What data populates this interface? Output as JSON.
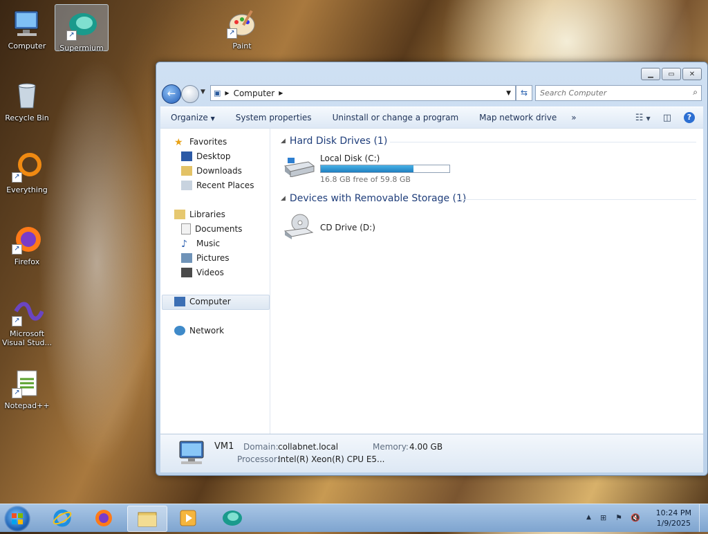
{
  "desktop": {
    "icons": [
      {
        "label": "Computer"
      },
      {
        "label": "Supermium"
      },
      {
        "label": "Paint"
      },
      {
        "label": "Recycle Bin"
      },
      {
        "label": "Everything"
      },
      {
        "label": "Firefox"
      },
      {
        "label": "Microsoft Visual Stud..."
      },
      {
        "label": "Notepad++"
      }
    ]
  },
  "window": {
    "address": {
      "crumb": "Computer"
    },
    "search": {
      "placeholder": "Search Computer"
    },
    "toolbar": {
      "organize": "Organize",
      "system_properties": "System properties",
      "uninstall": "Uninstall or change a program",
      "map_drive": "Map network drive",
      "more": "»"
    },
    "nav": {
      "favorites": "Favorites",
      "desktop": "Desktop",
      "downloads": "Downloads",
      "recent": "Recent Places",
      "libraries": "Libraries",
      "documents": "Documents",
      "music": "Music",
      "pictures": "Pictures",
      "videos": "Videos",
      "computer": "Computer",
      "network": "Network"
    },
    "groups": {
      "hdd_title": "Hard Disk Drives (1)",
      "removable_title": "Devices with Removable Storage (1)"
    },
    "drives": {
      "c_label": "Local Disk (C:)",
      "c_free": "16.8 GB free of 59.8 GB",
      "c_used_fraction": 0.72,
      "d_label": "CD Drive (D:)"
    },
    "details": {
      "name": "VM1",
      "domain_k": "Domain:",
      "domain_v": "collabnet.local",
      "memory_k": "Memory:",
      "memory_v": "4.00 GB",
      "processor_k": "Processor:",
      "processor_v": "Intel(R) Xeon(R) CPU E5..."
    }
  },
  "taskbar": {
    "time": "10:24 PM",
    "date": "1/9/2025"
  }
}
